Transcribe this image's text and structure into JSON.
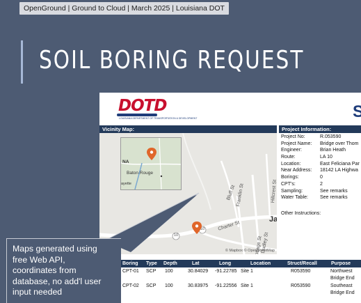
{
  "banner": {
    "text": "OpenGround | Ground to Cloud | March 2025 | Louisiana DOT"
  },
  "slide": {
    "title": "SOIL BORING REQUEST"
  },
  "document": {
    "logo": {
      "text": "DOTD",
      "subtitle": "LOUISIANA DEPARTMENT OF TRANSPORTATION & DEVELOPMENT"
    },
    "title_partial": "S",
    "vicinity_map": {
      "header": "Vicinity Map:",
      "inset_labels": {
        "region": "NA",
        "city": "Baton Rouge",
        "edge": "ayette"
      },
      "road_labels": [
        "Charter St",
        "Franklin St",
        "Cottage St",
        "Dudley St",
        "Bluff St",
        "Hillcrest St"
      ],
      "route_markers": [
        "10",
        "19",
        "10"
      ],
      "place_labels": [
        "Ja"
      ],
      "copyright": "© Mapbox © OpenStreetMap"
    },
    "project_info": {
      "header": "Project Information:",
      "rows": [
        {
          "label": "Project No:",
          "value": "R.053590"
        },
        {
          "label": "Project Name:",
          "value": "Bridge over Thom"
        },
        {
          "label": "Engineer:",
          "value": "Brian Heath"
        },
        {
          "label": "Route:",
          "value": "LA 10"
        },
        {
          "label": "Location:",
          "value": "East Feliciana Par"
        },
        {
          "label": "Near Address:",
          "value": "18142 LA Highwa"
        },
        {
          "label": "Borings:",
          "value": "0"
        },
        {
          "label": "CPT's:",
          "value": "2"
        },
        {
          "label": "Sampling:",
          "value": "See remarks"
        },
        {
          "label": "Water Table:",
          "value": "See remarks"
        }
      ],
      "other_instructions": "Other Instructions:"
    },
    "borings": {
      "columns": [
        "Boring",
        "Type",
        "Depth",
        "Lat",
        "Long",
        "Location",
        "Struct/Recall",
        "Purpose"
      ],
      "rows": [
        {
          "boring": "CPT-01",
          "type": "SCP",
          "depth": "100",
          "lat": "30.84029",
          "long": "-91.22785",
          "location": "Site 1",
          "struct": "R053590",
          "purpose": "Northwest",
          "purpose2": "Bridge End"
        },
        {
          "boring": "CPT-02",
          "type": "SCP",
          "depth": "100",
          "lat": "30.83975",
          "long": "-91.22556",
          "location": "Site 1",
          "struct": "R053590",
          "purpose": "Southeast",
          "purpose2": "Bridge End"
        }
      ]
    }
  },
  "callout": {
    "text": "Maps generated using\nfree Web API,\ncoordinates from\ndatabase, no add'l user\ninput needed"
  },
  "colors": {
    "slide_bg": "#4d5b73",
    "header_navy": "#233a5a",
    "pin_orange": "#e0662a",
    "logo_red": "#c8102e"
  }
}
